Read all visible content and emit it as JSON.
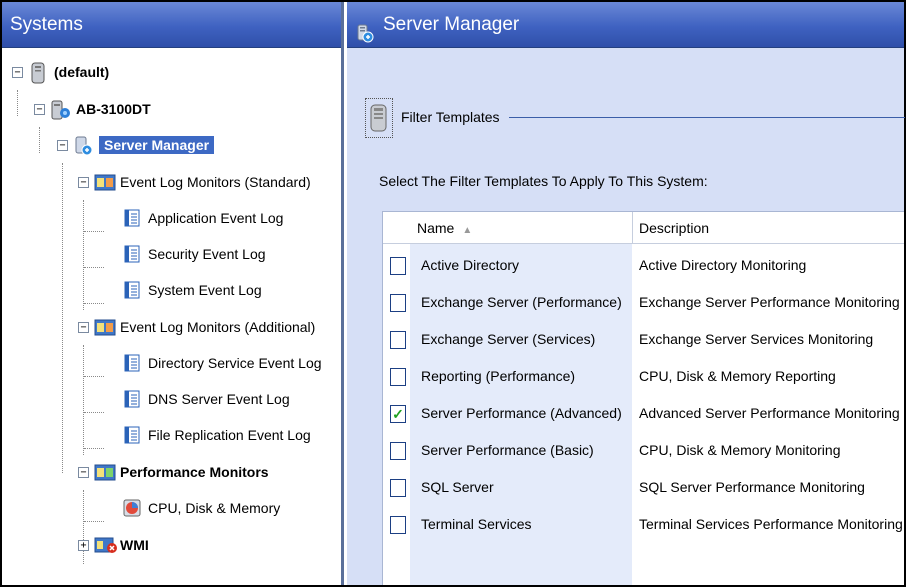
{
  "left_panel": {
    "title": "Systems",
    "tree": [
      {
        "label": "(default)",
        "icon": "server-icon",
        "expander": "⊟",
        "bold": true
      },
      {
        "label": "AB-3100DT",
        "icon": "computer-icon",
        "expander": "⊟",
        "bold": true
      },
      {
        "label": "Server Manager",
        "icon": "server-manager-icon",
        "expander": "⊟",
        "bold": true,
        "selected": true
      },
      {
        "label": "Event Log Monitors (Standard)",
        "icon": "event-log-folder-icon",
        "expander": "⊟"
      },
      {
        "label": "Application Event Log",
        "icon": "log-icon"
      },
      {
        "label": "Security Event Log",
        "icon": "log-icon"
      },
      {
        "label": "System Event Log",
        "icon": "log-icon"
      },
      {
        "label": "Event Log Monitors (Additional)",
        "icon": "event-log-folder-icon",
        "expander": "⊟"
      },
      {
        "label": "Directory Service Event Log",
        "icon": "log-icon"
      },
      {
        "label": "DNS Server Event Log",
        "icon": "log-icon"
      },
      {
        "label": "File Replication Event Log",
        "icon": "log-icon"
      },
      {
        "label": "Performance Monitors",
        "icon": "performance-folder-icon",
        "expander": "⊟",
        "bold": true
      },
      {
        "label": "CPU, Disk & Memory",
        "icon": "cpu-disk-memory-icon"
      },
      {
        "label": "WMI",
        "icon": "wmi-icon",
        "expander": "⊞",
        "bold": true
      }
    ]
  },
  "right_panel": {
    "title": "Server Manager",
    "filter_legend": "Filter Templates",
    "instruction": "Select The Filter Templates To Apply To This System:",
    "columns": {
      "name": "Name",
      "description": "Description"
    },
    "rows": [
      {
        "name": "Active Directory",
        "description": "Active Directory Monitoring",
        "checked": false
      },
      {
        "name": "Exchange Server (Performance)",
        "description": "Exchange Server Performance Monitoring",
        "checked": false
      },
      {
        "name": "Exchange Server (Services)",
        "description": "Exchange Server Services Monitoring",
        "checked": false
      },
      {
        "name": "Reporting (Performance)",
        "description": "CPU, Disk & Memory Reporting",
        "checked": false
      },
      {
        "name": "Server Performance (Advanced)",
        "description": "Advanced Server Performance Monitoring",
        "checked": true
      },
      {
        "name": "Server Performance (Basic)",
        "description": "CPU, Disk & Memory Monitoring",
        "checked": false
      },
      {
        "name": "SQL Server",
        "description": "SQL Server Performance Monitoring",
        "checked": false
      },
      {
        "name": "Terminal Services",
        "description": "Terminal Services Performance Monitoring",
        "checked": false
      }
    ]
  }
}
